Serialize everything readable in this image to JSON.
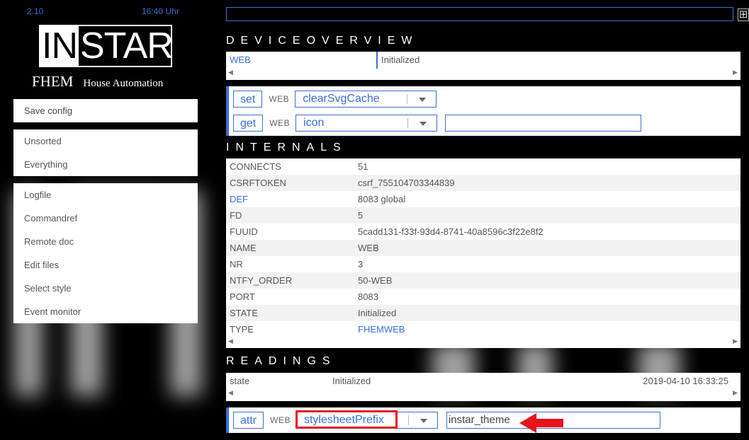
{
  "header": {
    "version": "2.10",
    "time": "16:40 Uhr",
    "logo_inverted": "IN",
    "logo_rest": "STAR",
    "subtitle_main": "FHEM",
    "subtitle_small": "House Automation"
  },
  "menu": {
    "save_config": "Save config",
    "groups": [
      {
        "items": [
          "Unsorted",
          "Everything"
        ]
      },
      {
        "items": [
          "Logfile",
          "Commandref",
          "Remote doc",
          "Edit files",
          "Select style",
          "Event monitor"
        ]
      }
    ]
  },
  "command_input": {
    "value": ""
  },
  "plus_icon": "⊞",
  "device_overview": {
    "title": "DEVICEOVERVIEW",
    "name": "WEB",
    "state": "Initialized"
  },
  "set_row": {
    "button": "set",
    "device": "WEB",
    "selected": "clearSvgCache"
  },
  "get_row": {
    "button": "get",
    "device": "WEB",
    "selected": "icon",
    "value": ""
  },
  "internals": {
    "title": "INTERNALS",
    "rows": [
      {
        "key": "CONNECTS",
        "value": "51"
      },
      {
        "key": "CSRFTOKEN",
        "value": "csrf_755104703344839"
      },
      {
        "key": "DEF",
        "value": "8083 global"
      },
      {
        "key": "FD",
        "value": "5"
      },
      {
        "key": "FUUID",
        "value": "5cadd131-f33f-93d4-8741-40a8596c3f22e8f2"
      },
      {
        "key": "NAME",
        "value": "WEB"
      },
      {
        "key": "NR",
        "value": "3"
      },
      {
        "key": "NTFY_ORDER",
        "value": "50-WEB"
      },
      {
        "key": "PORT",
        "value": "8083"
      },
      {
        "key": "STATE",
        "value": "Initialized"
      },
      {
        "key": "TYPE",
        "value": "FHEMWEB"
      }
    ]
  },
  "readings": {
    "title": "READINGS",
    "rows": [
      {
        "key": "state",
        "value": "Initialized",
        "time": "2019-04-10 16:33:25"
      }
    ]
  },
  "attr_row": {
    "button": "attr",
    "device": "WEB",
    "selected": "stylesheetPrefix",
    "value": "instar_theme"
  },
  "colors": {
    "accent": "#3a6fd8",
    "highlight": "#e8141b",
    "background": "#000000"
  }
}
